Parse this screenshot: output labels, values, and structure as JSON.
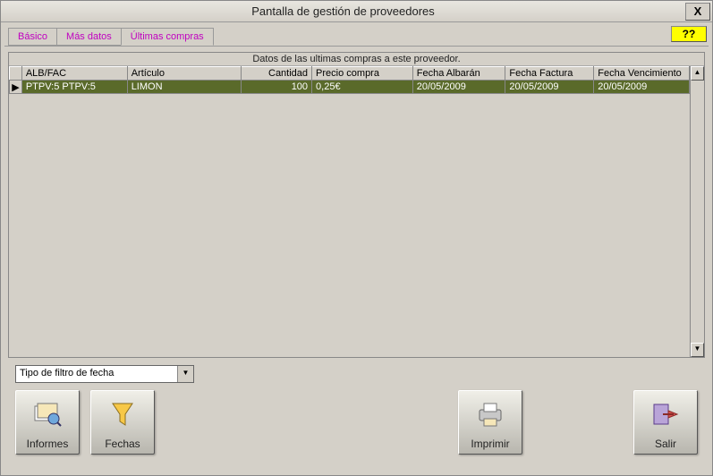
{
  "window": {
    "title": "Pantalla de gestión de proveedores",
    "close": "X"
  },
  "tabs": [
    {
      "label": "Básico"
    },
    {
      "label": "Más datos"
    },
    {
      "label": "Últimas compras"
    }
  ],
  "help": "??",
  "grid": {
    "caption": "Datos de las ultimas compras a este proveedor.",
    "columns": [
      "ALB/FAC",
      "Artículo",
      "Cantidad",
      "Precio compra",
      "Fecha Albarán",
      "Fecha Factura",
      "Fecha Vencimiento"
    ],
    "rows": [
      {
        "alb_fac": "PTPV:5 PTPV:5",
        "articulo": "LIMON",
        "cantidad": "100",
        "precio": "0,25€",
        "f_albaran": "20/05/2009",
        "f_factura": "20/05/2009",
        "f_venc": "20/05/2009"
      }
    ],
    "row_marker": "▶"
  },
  "filter": {
    "placeholder": "Tipo de filtro de fecha"
  },
  "buttons": {
    "informes": "Informes",
    "fechas": "Fechas",
    "imprimir": "Imprimir",
    "salir": "Salir"
  }
}
